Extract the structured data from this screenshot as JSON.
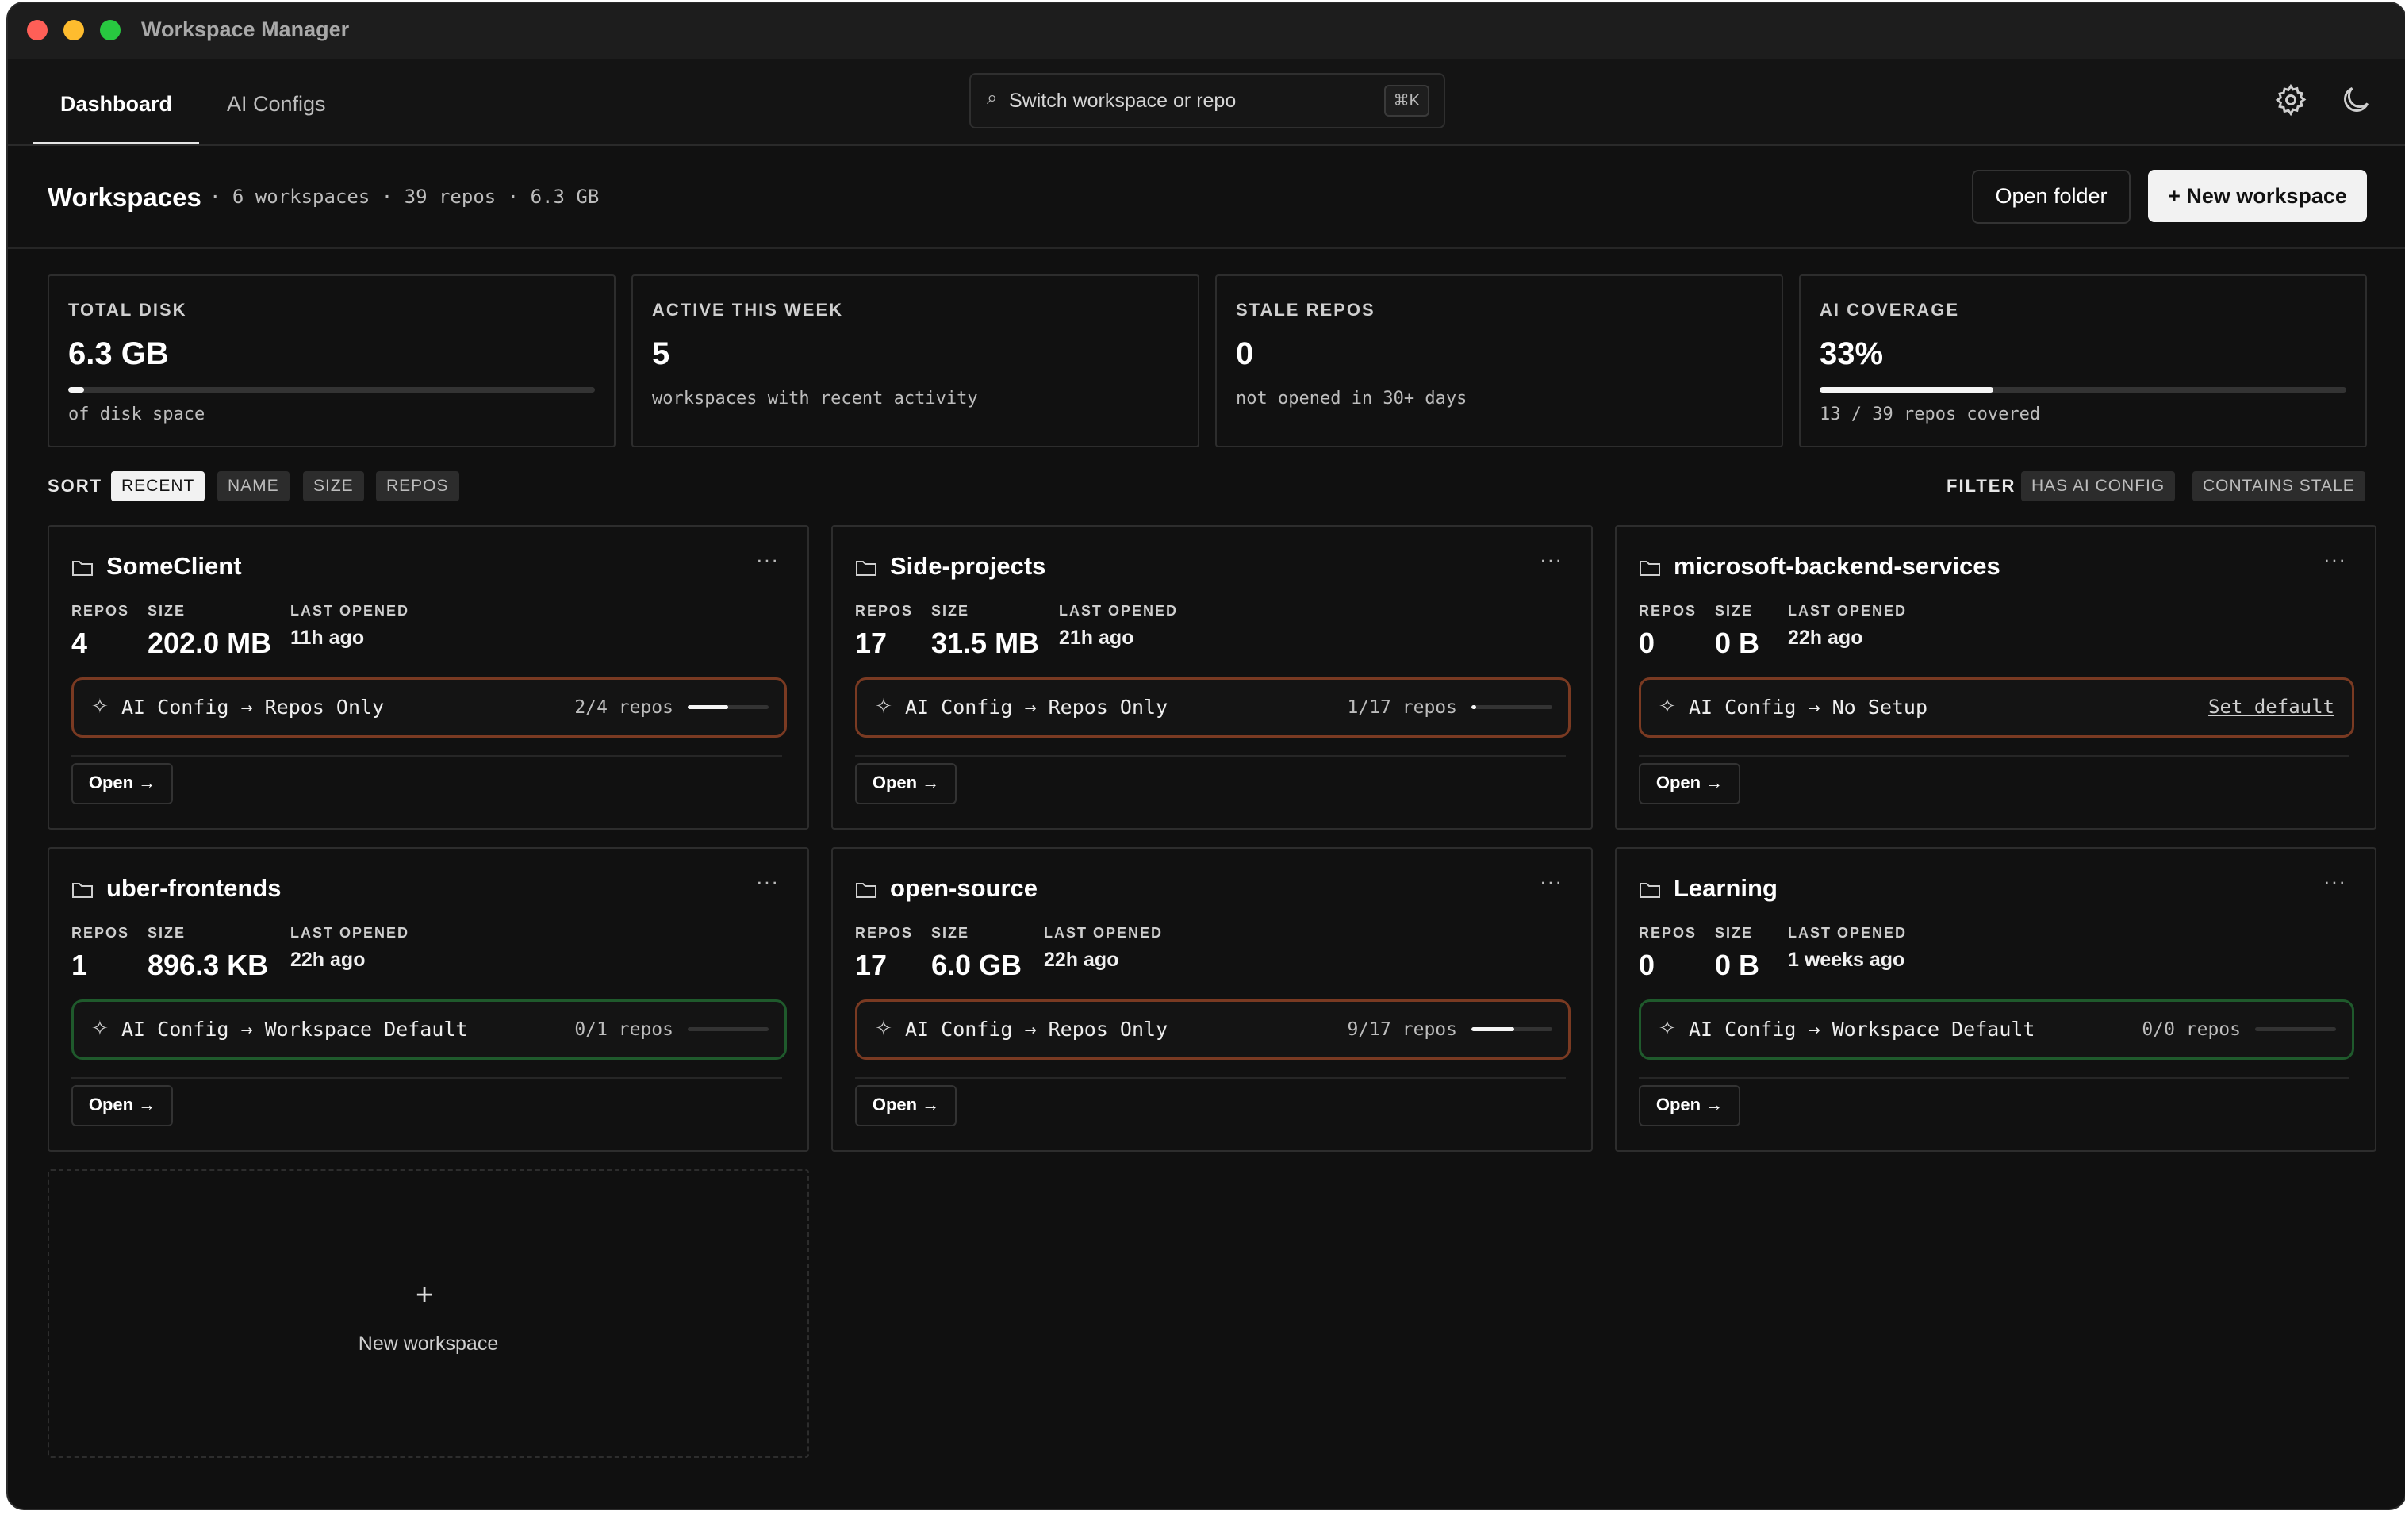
{
  "window": {
    "title": "Workspace Manager"
  },
  "nav": {
    "tabs": [
      {
        "label": "Dashboard"
      },
      {
        "label": "AI Configs"
      }
    ],
    "search": {
      "label": "Switch workspace or repo",
      "shortcut": "⌘K"
    }
  },
  "header": {
    "title": "Workspaces",
    "meta": "· 6 workspaces · 39 repos · 6.3 GB",
    "open_folder": "Open folder",
    "new_workspace": "+ New workspace"
  },
  "stats": [
    {
      "label": "TOTAL DISK",
      "value": "6.3 GB",
      "sub": "of disk space",
      "progress": 0.03
    },
    {
      "label": "ACTIVE THIS WEEK",
      "value": "5",
      "sub": "workspaces with recent activity"
    },
    {
      "label": "STALE REPOS",
      "value": "0",
      "sub": "not opened in 30+ days"
    },
    {
      "label": "AI COVERAGE",
      "value": "33%",
      "sub": "13 / 39 repos covered",
      "progress": 0.33
    }
  ],
  "sort": {
    "label": "SORT",
    "options": [
      "RECENT",
      "NAME",
      "SIZE",
      "REPOS"
    ],
    "active": "RECENT"
  },
  "filter": {
    "label": "FILTER",
    "options": [
      "HAS AI CONFIG",
      "CONTAINS STALE"
    ]
  },
  "card_labels": {
    "repos": "REPOS",
    "size": "SIZE",
    "last_opened": "LAST OPENED",
    "open": "Open →"
  },
  "workspaces": [
    {
      "name": "SomeClient",
      "repos": "4",
      "size": "202.0 MB",
      "last_opened": "11h ago",
      "ai_config": "AI Config → Repos Only",
      "ai_count": "2/4 repos",
      "ai_progress": 0.5,
      "status_color": "#7a3a22"
    },
    {
      "name": "Side-projects",
      "repos": "17",
      "size": "31.5 MB",
      "last_opened": "21h ago",
      "ai_config": "AI Config → Repos Only",
      "ai_count": "1/17 repos",
      "ai_progress": 0.06,
      "status_color": "#7a3a22"
    },
    {
      "name": "microsoft-backend-services",
      "repos": "0",
      "size": "0 B",
      "last_opened": "22h ago",
      "ai_config": "AI Config → No Setup",
      "ai_link": "Set default",
      "status_color": "#7a3a22"
    },
    {
      "name": "uber-frontends",
      "repos": "1",
      "size": "896.3 KB",
      "last_opened": "22h ago",
      "ai_config": "AI Config → Workspace Default",
      "ai_count": "0/1 repos",
      "ai_progress": 0,
      "status_color": "#1f5a2c"
    },
    {
      "name": "open-source",
      "repos": "17",
      "size": "6.0 GB",
      "last_opened": "22h ago",
      "ai_config": "AI Config → Repos Only",
      "ai_count": "9/17 repos",
      "ai_progress": 0.53,
      "status_color": "#7a3a22"
    },
    {
      "name": "Learning",
      "repos": "0",
      "size": "0 B",
      "last_opened": "1 weeks ago",
      "ai_config": "AI Config → Workspace Default",
      "ai_count": "0/0 repos",
      "ai_progress": 0,
      "status_color": "#1f5a2c"
    }
  ],
  "new_card": {
    "plus": "+",
    "label": "New workspace"
  }
}
